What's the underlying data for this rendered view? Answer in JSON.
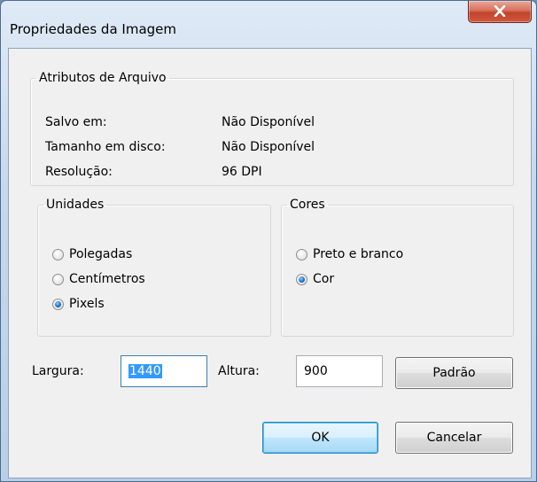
{
  "window": {
    "title": "Propriedades da Imagem"
  },
  "file_attributes": {
    "legend": "Atributos de Arquivo",
    "rows": [
      {
        "label": "Salvo em:",
        "value": "Não Disponível"
      },
      {
        "label": "Tamanho em disco:",
        "value": "Não Disponível"
      },
      {
        "label": "Resolução:",
        "value": "96 DPI"
      }
    ]
  },
  "units": {
    "legend": "Unidades",
    "options": [
      {
        "label": "Polegadas",
        "checked": false
      },
      {
        "label": "Centímetros",
        "checked": false
      },
      {
        "label": "Pixels",
        "checked": true
      }
    ]
  },
  "colors": {
    "legend": "Cores",
    "options": [
      {
        "label": "Preto e branco",
        "checked": false
      },
      {
        "label": "Cor",
        "checked": true
      }
    ]
  },
  "size": {
    "width_label": "Largura:",
    "width_value": "1440",
    "height_label": "Altura:",
    "height_value": "900",
    "default_button": "Padrão"
  },
  "buttons": {
    "ok": "OK",
    "cancel": "Cancelar"
  },
  "theme": {
    "selection_color": "#3399ff",
    "radio_checked_color": "#1d72c9",
    "close_button_color": "#c2432b"
  }
}
